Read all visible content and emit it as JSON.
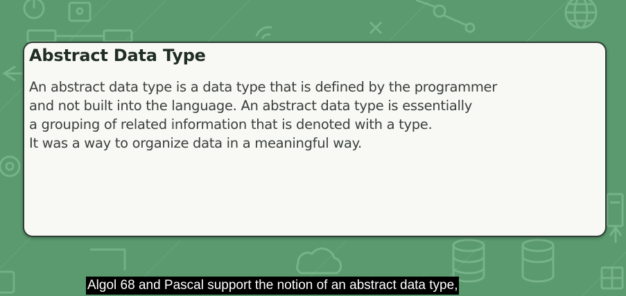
{
  "slide": {
    "title": "Abstract Data Type",
    "body_lines": [
      "An abstract data type is a data type that is defined by the programmer",
      "and not built into the language. An abstract data type is essentially",
      "a grouping of related information that is denoted with a type.",
      "It was a way to organize data in a meaningful way."
    ]
  },
  "subtitle": {
    "text": "Algol 68 and Pascal support the notion of an abstract data type,"
  },
  "colors": {
    "background": "#5a9a6e",
    "card": "#f8f8f4",
    "card_border": "#2e3b33",
    "title": "#1f2d24",
    "body_text": "#3a3f3b",
    "caption_bg": "#000000",
    "caption_text": "#ffffff"
  },
  "background_icons": [
    "power-icon",
    "padlock-icon",
    "flowchart-icon",
    "network-node-icon",
    "globe-icon",
    "wifi-icon",
    "close-icon",
    "arrow-left-icon",
    "gear-icon",
    "cloud-icon",
    "database-icon",
    "server-tower-icon",
    "windows-icon",
    "arrow-up-icon"
  ]
}
